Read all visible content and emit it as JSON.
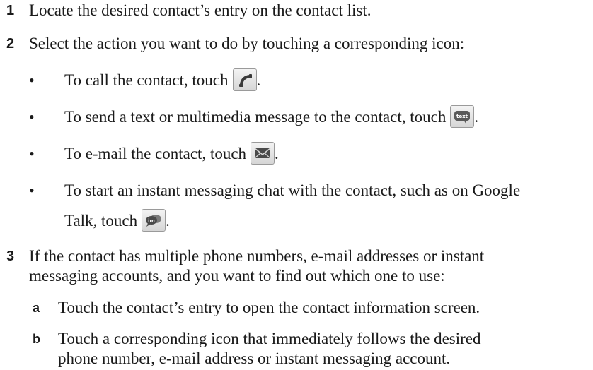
{
  "steps": [
    {
      "number": "1",
      "text": "Locate the desired contact’s entry on the contact list."
    },
    {
      "number": "2",
      "text": "Select the action you want to do by touching a corresponding icon:"
    },
    {
      "number": "3",
      "text_line1": "If the contact has multiple phone numbers, e-mail addresses or instant",
      "text_line2": "messaging accounts, and you want to find out which one to use:"
    }
  ],
  "bullets": [
    {
      "symbol": "•",
      "text": "To call the contact, touch",
      "icon": "phone-icon",
      "end": "."
    },
    {
      "symbol": "•",
      "text": "To send a text or multimedia message to the contact, touch",
      "icon": "text-message-icon",
      "icon_label": "text",
      "end": "."
    },
    {
      "symbol": "•",
      "text": "To e-mail the contact, touch",
      "icon": "envelope-icon",
      "end": "."
    },
    {
      "symbol": "•",
      "text_line1": "To start an instant messaging chat with the contact, such as on Google",
      "text_line2": "Talk, touch",
      "icon": "im-chat-icon",
      "icon_label": "im",
      "end": "."
    }
  ],
  "substeps": [
    {
      "letter": "a",
      "text": "Touch the contact’s entry to open the contact information screen."
    },
    {
      "letter": "b",
      "text_line1": "Touch a corresponding icon that immediately follows the desired",
      "text_line2": "phone number, e-mail address or instant messaging account."
    }
  ]
}
